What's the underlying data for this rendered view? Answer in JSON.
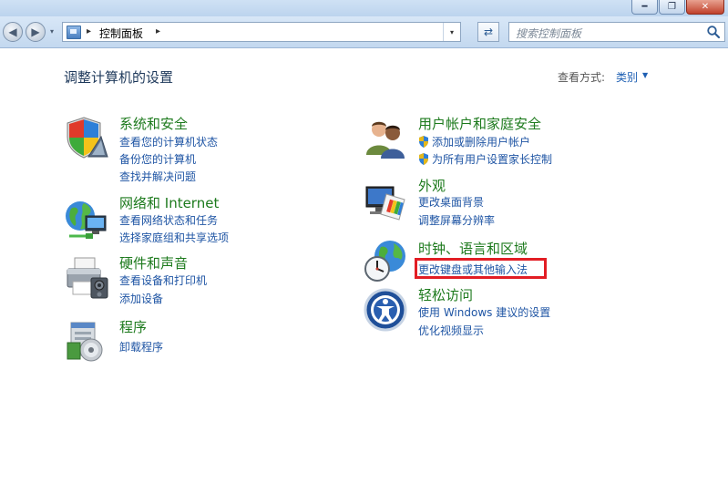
{
  "window": {
    "minimize": "━",
    "maximize": "❐",
    "close": "✕"
  },
  "nav": {
    "back": "◀",
    "forward": "▶",
    "dropdown": "▾"
  },
  "address": {
    "separator": "▸",
    "path": "控制面板",
    "dropdown": "▾"
  },
  "refresh": "⇄",
  "search": {
    "placeholder": "搜索控制面板"
  },
  "page": {
    "title": "调整计算机的设置",
    "view_by_label": "查看方式:",
    "view_by_value": "类别",
    "view_by_arrow": "▼"
  },
  "categories_left": [
    {
      "title": "系统和安全",
      "icon": "shield-icon",
      "links": [
        "查看您的计算机状态",
        "备份您的计算机",
        "查找并解决问题"
      ]
    },
    {
      "title": "网络和 Internet",
      "icon": "network-globe-icon",
      "links": [
        "查看网络状态和任务",
        "选择家庭组和共享选项"
      ]
    },
    {
      "title": "硬件和声音",
      "icon": "printer-icon",
      "links": [
        "查看设备和打印机",
        "添加设备"
      ]
    },
    {
      "title": "程序",
      "icon": "programs-icon",
      "links": [
        "卸载程序"
      ]
    }
  ],
  "categories_right": [
    {
      "title": "用户帐户和家庭安全",
      "icon": "users-icon",
      "links": [
        "添加或删除用户帐户",
        "为所有用户设置家长控制"
      ]
    },
    {
      "title": "外观",
      "icon": "appearance-monitor-icon",
      "links": [
        "更改桌面背景",
        "调整屏幕分辨率"
      ]
    },
    {
      "title": "时钟、语言和区域",
      "icon": "clock-globe-icon",
      "links": [
        "更改键盘或其他输入法"
      ]
    },
    {
      "title": "轻松访问",
      "icon": "ease-of-access-icon",
      "links": [
        "使用 Windows 建议的设置",
        "优化视频显示"
      ]
    }
  ],
  "colors": {
    "category_title": "#1d7a1d",
    "link": "#1f55a4",
    "highlight": "#e21d24"
  }
}
